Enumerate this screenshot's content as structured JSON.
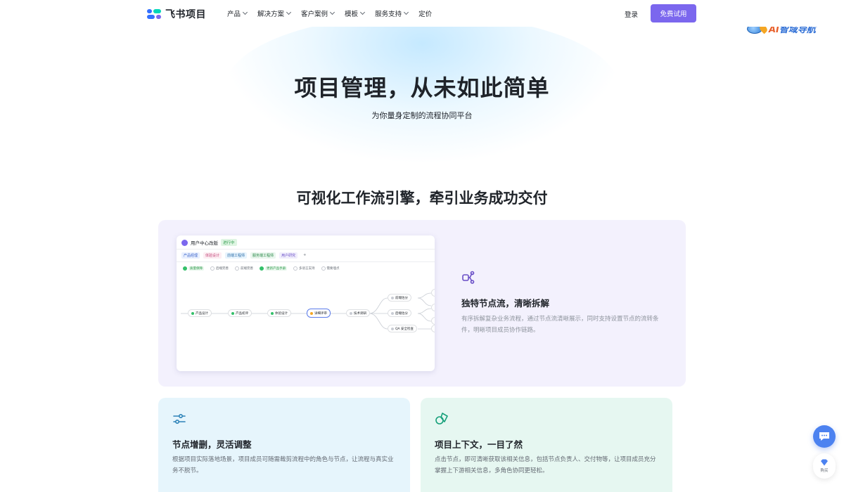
{
  "nav": {
    "logo_text": "飞书项目",
    "menu": [
      {
        "label": "产品",
        "has_dropdown": true
      },
      {
        "label": "解决方案",
        "has_dropdown": true
      },
      {
        "label": "客户案例",
        "has_dropdown": true
      },
      {
        "label": "模板",
        "has_dropdown": true
      },
      {
        "label": "服务支持",
        "has_dropdown": true
      },
      {
        "label": "定价",
        "has_dropdown": false
      }
    ],
    "login": "登录",
    "trial_button": "免费试用",
    "brand_color": "#7b67ee"
  },
  "watermark": {
    "prefix": "AI",
    "text": "智域导航"
  },
  "hero": {
    "title": "项目管理，从未如此简单",
    "subtitle": "为你量身定制的流程协同平台"
  },
  "section": {
    "title": "可视化工作流引擎，牵引业务成功交付"
  },
  "feature_main": {
    "icon": "node-flow-icon",
    "title": "独特节点流，清晰拆解",
    "desc": "有序拆解复杂业务流程，通过节点流清晰展示，同时支持设置节点的流转条件，明晰项目成员协作链路。",
    "screenshot": {
      "project": "用户中心改版",
      "status": "进行中",
      "roles": [
        "产品经理",
        "体验设计",
        "前端工程师",
        "服务端工程师",
        "用户研究"
      ],
      "add": "+",
      "filters": [
        {
          "label": "质量保障",
          "checked": true
        },
        {
          "label": "后端完善",
          "checked": false
        },
        {
          "label": "前端完善",
          "checked": false
        },
        {
          "label": "更新产品手册",
          "checked": true
        },
        {
          "label": "多语言支持",
          "checked": false
        },
        {
          "label": "需要埋点",
          "checked": false
        }
      ],
      "nodes": [
        "产品设计",
        "产品初评",
        "体验设计",
        "详细评审",
        "技术调研",
        "前端估分",
        "后端估分",
        "QA 安全检查"
      ]
    }
  },
  "feature_left": {
    "icon": "slider-adjust-icon",
    "title": "节点增删，灵活调整",
    "desc": "根据项目实际落地场景，项目成员可随需裁剪流程中的角色与节点，让流程与真实业务不脱节。"
  },
  "feature_right": {
    "icon": "context-shapes-icon",
    "title": "项目上下文，一目了然",
    "desc": "点击节点，即可清晰获取该相关信息，包括节点负责人、交付物等，让项目成员充分掌握上下游相关信息，多角色协同更轻松。"
  },
  "floating": {
    "chat_icon": "chat-bubble-icon",
    "buy_icon": "diamond-icon",
    "buy_label": "购买"
  }
}
